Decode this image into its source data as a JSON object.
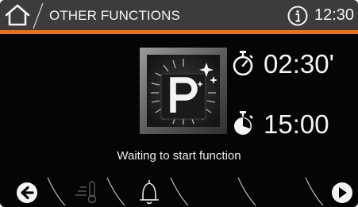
{
  "header": {
    "title": "OTHER FUNCTIONS",
    "time": "12:30",
    "home_icon": "home-icon",
    "info_icon": "info-icon"
  },
  "colors": {
    "accent": "#e8731f",
    "header_bg": "#3c3c3c",
    "screen_bg": "#050505",
    "text": "#f4f4f4"
  },
  "main": {
    "function_icon": "pyrolysis-clean-icon",
    "function_letter": "P",
    "duration_icon": "stopwatch-icon",
    "duration": "02:30'",
    "end_time_icon": "end-timer-icon",
    "end_time": "15:00",
    "status": "Waiting to start function"
  },
  "footer": {
    "items": [
      "back-arrow-icon",
      "thermometer-icon",
      "bell-icon",
      "empty",
      "empty",
      "forward-arrow-icon"
    ]
  }
}
